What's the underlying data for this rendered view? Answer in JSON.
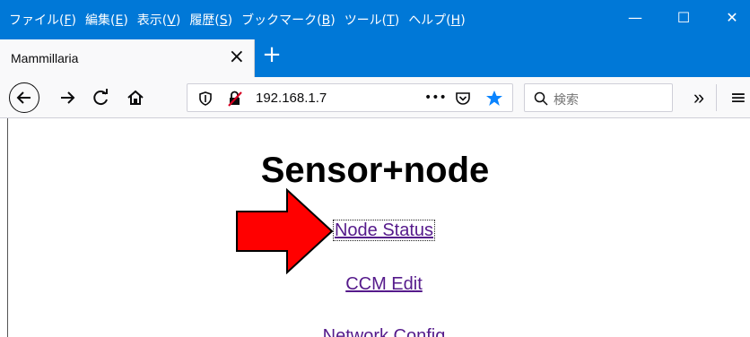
{
  "menu": [
    {
      "label": "ファイル(",
      "acc": "F",
      "tail": ")"
    },
    {
      "label": "編集(",
      "acc": "E",
      "tail": ")"
    },
    {
      "label": "表示(",
      "acc": "V",
      "tail": ")"
    },
    {
      "label": "履歴(",
      "acc": "S",
      "tail": ")"
    },
    {
      "label": "ブックマーク(",
      "acc": "B",
      "tail": ")"
    },
    {
      "label": "ツール(",
      "acc": "T",
      "tail": ")"
    },
    {
      "label": "ヘルプ(",
      "acc": "H",
      "tail": ")"
    }
  ],
  "window": {
    "minimize": "—",
    "maximize": "☐",
    "close": "✕"
  },
  "tab": {
    "title": "Mammillaria",
    "close": "×",
    "new_tab": "+"
  },
  "nav": {
    "url": "192.168.1.7",
    "page_actions": "•••",
    "search_placeholder": "検索",
    "overflow": "»",
    "menu": "≡"
  },
  "page": {
    "title": "Sensor+node",
    "links": [
      "Node Status",
      "CCM Edit",
      "Network Config"
    ]
  },
  "colors": {
    "titlebar": "#0078d7",
    "link": "#551a8b",
    "arrow": "#ff0000",
    "bookmark_star": "#0a84ff"
  }
}
